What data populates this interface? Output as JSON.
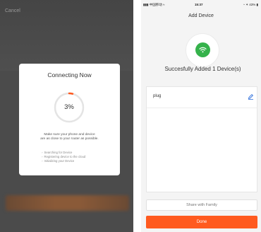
{
  "left_screen": {
    "cancel_label": "Cancel",
    "modal": {
      "title": "Connecting Now",
      "progress_text": "3%",
      "progress_fraction": 0.03,
      "message_line1": "Make sure your phone and device",
      "message_line2": "are as close to your router as possible.",
      "steps": [
        "Searching for Device",
        "Registering device to the cloud",
        "Initializing your Device"
      ]
    },
    "colors": {
      "overlay": "#4b4b4b",
      "progress_accent": "#ff5a1f",
      "ring_track": "#e4e4e4"
    }
  },
  "right_screen": {
    "status_bar": {
      "carrier": "中国移动",
      "time": "15:37",
      "battery": "43%"
    },
    "nav_title": "Add Device",
    "device_icon": "wifi-icon",
    "success_message": "Succesfully Added 1 Device(s)",
    "device": {
      "name": "plug",
      "edit_icon": "pencil-icon"
    },
    "share_label": "Share with Family",
    "done_label": "Done",
    "colors": {
      "success_green": "#35b24b",
      "done_orange": "#ff5a1f",
      "edit_blue": "#2f6fdc"
    }
  }
}
